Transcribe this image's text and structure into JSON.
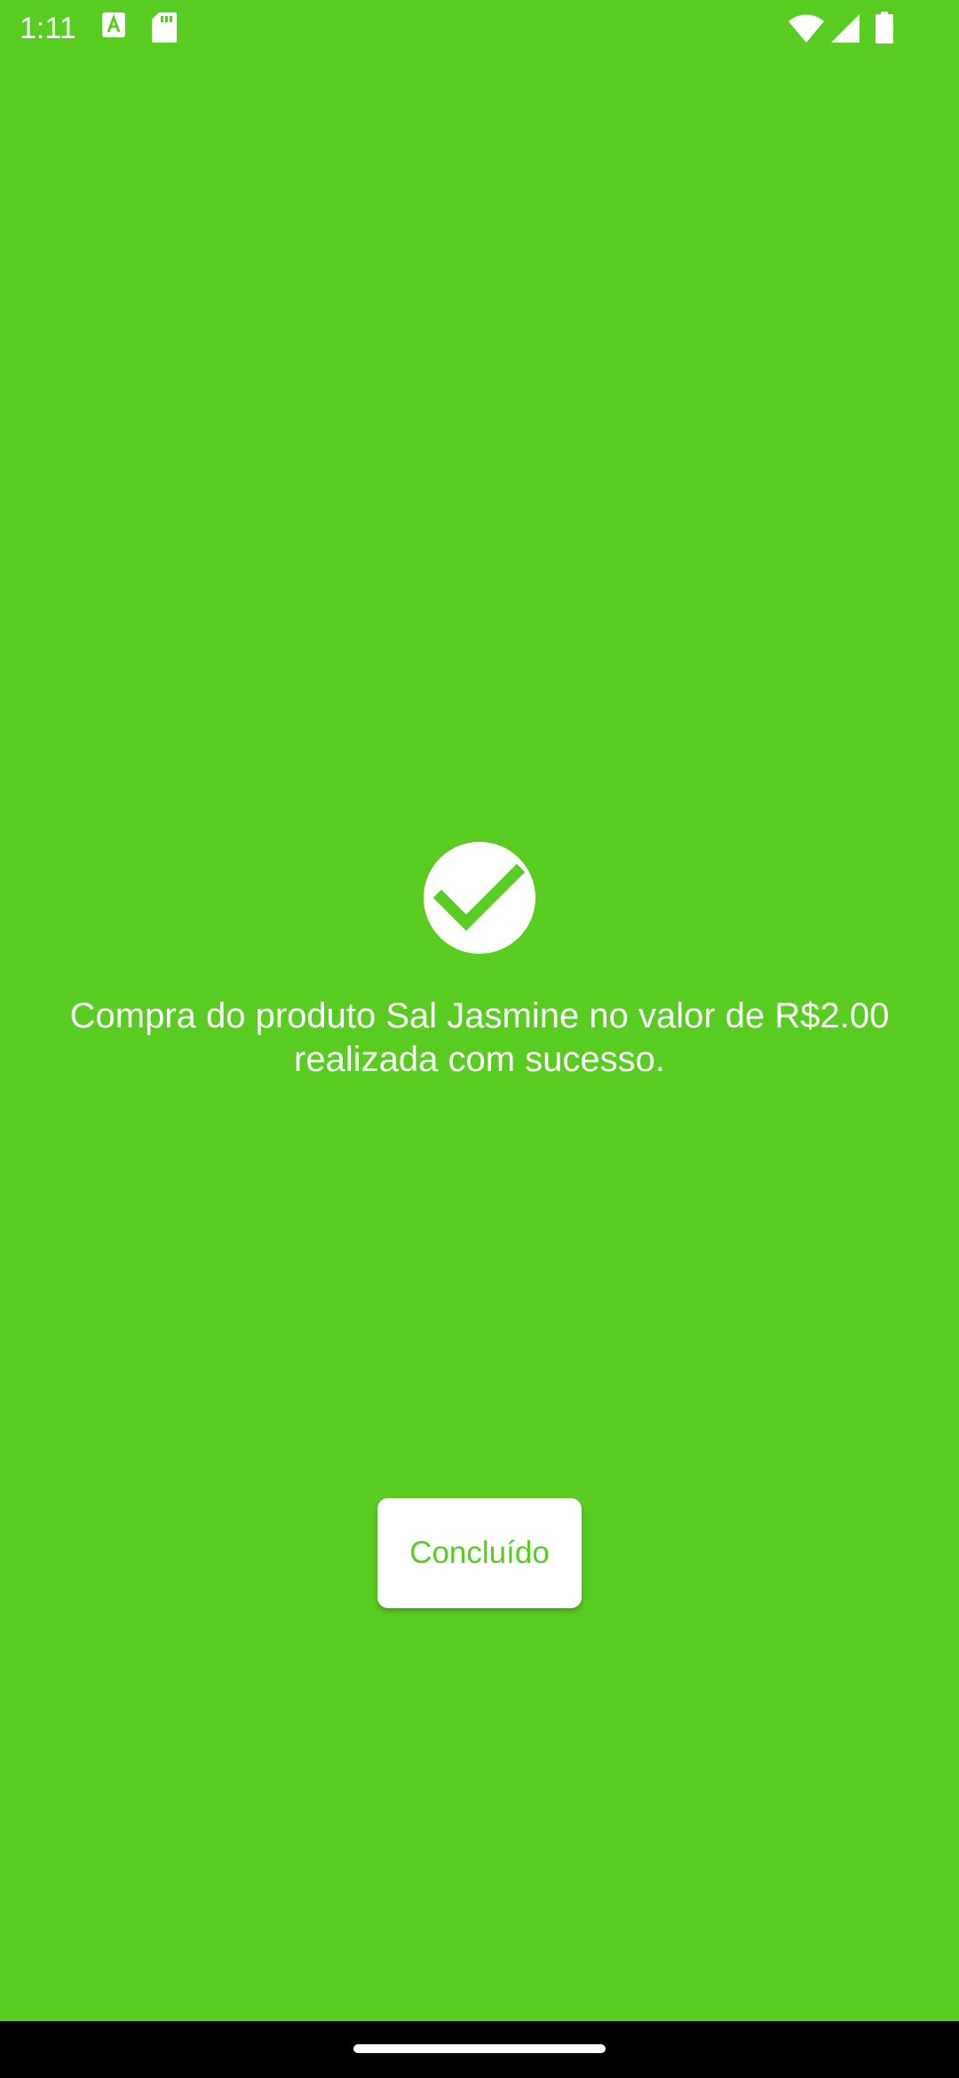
{
  "status_bar": {
    "time": "1:11",
    "icons": [
      "a-notification-icon",
      "sd-card-icon",
      "wifi-icon",
      "signal-icon",
      "battery-icon"
    ]
  },
  "success": {
    "icon": "check-circle-icon",
    "message": "Compra do produto Sal Jasmine no valor de R$2.00 realizada com sucesso."
  },
  "actions": {
    "done_label": "Concluído"
  },
  "colors": {
    "background": "#59cc22",
    "button_background": "#ffffff",
    "button_text": "#59cc22",
    "text": "#ffffff"
  }
}
